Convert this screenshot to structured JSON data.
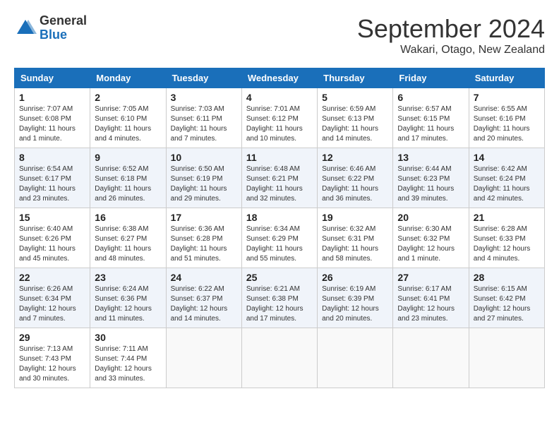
{
  "logo": {
    "general": "General",
    "blue": "Blue"
  },
  "header": {
    "month": "September 2024",
    "location": "Wakari, Otago, New Zealand"
  },
  "weekdays": [
    "Sunday",
    "Monday",
    "Tuesday",
    "Wednesday",
    "Thursday",
    "Friday",
    "Saturday"
  ],
  "weeks": [
    [
      {
        "day": "1",
        "info": "Sunrise: 7:07 AM\nSunset: 6:08 PM\nDaylight: 11 hours\nand 1 minute."
      },
      {
        "day": "2",
        "info": "Sunrise: 7:05 AM\nSunset: 6:10 PM\nDaylight: 11 hours\nand 4 minutes."
      },
      {
        "day": "3",
        "info": "Sunrise: 7:03 AM\nSunset: 6:11 PM\nDaylight: 11 hours\nand 7 minutes."
      },
      {
        "day": "4",
        "info": "Sunrise: 7:01 AM\nSunset: 6:12 PM\nDaylight: 11 hours\nand 10 minutes."
      },
      {
        "day": "5",
        "info": "Sunrise: 6:59 AM\nSunset: 6:13 PM\nDaylight: 11 hours\nand 14 minutes."
      },
      {
        "day": "6",
        "info": "Sunrise: 6:57 AM\nSunset: 6:15 PM\nDaylight: 11 hours\nand 17 minutes."
      },
      {
        "day": "7",
        "info": "Sunrise: 6:55 AM\nSunset: 6:16 PM\nDaylight: 11 hours\nand 20 minutes."
      }
    ],
    [
      {
        "day": "8",
        "info": "Sunrise: 6:54 AM\nSunset: 6:17 PM\nDaylight: 11 hours\nand 23 minutes."
      },
      {
        "day": "9",
        "info": "Sunrise: 6:52 AM\nSunset: 6:18 PM\nDaylight: 11 hours\nand 26 minutes."
      },
      {
        "day": "10",
        "info": "Sunrise: 6:50 AM\nSunset: 6:19 PM\nDaylight: 11 hours\nand 29 minutes."
      },
      {
        "day": "11",
        "info": "Sunrise: 6:48 AM\nSunset: 6:21 PM\nDaylight: 11 hours\nand 32 minutes."
      },
      {
        "day": "12",
        "info": "Sunrise: 6:46 AM\nSunset: 6:22 PM\nDaylight: 11 hours\nand 36 minutes."
      },
      {
        "day": "13",
        "info": "Sunrise: 6:44 AM\nSunset: 6:23 PM\nDaylight: 11 hours\nand 39 minutes."
      },
      {
        "day": "14",
        "info": "Sunrise: 6:42 AM\nSunset: 6:24 PM\nDaylight: 11 hours\nand 42 minutes."
      }
    ],
    [
      {
        "day": "15",
        "info": "Sunrise: 6:40 AM\nSunset: 6:26 PM\nDaylight: 11 hours\nand 45 minutes."
      },
      {
        "day": "16",
        "info": "Sunrise: 6:38 AM\nSunset: 6:27 PM\nDaylight: 11 hours\nand 48 minutes."
      },
      {
        "day": "17",
        "info": "Sunrise: 6:36 AM\nSunset: 6:28 PM\nDaylight: 11 hours\nand 51 minutes."
      },
      {
        "day": "18",
        "info": "Sunrise: 6:34 AM\nSunset: 6:29 PM\nDaylight: 11 hours\nand 55 minutes."
      },
      {
        "day": "19",
        "info": "Sunrise: 6:32 AM\nSunset: 6:31 PM\nDaylight: 11 hours\nand 58 minutes."
      },
      {
        "day": "20",
        "info": "Sunrise: 6:30 AM\nSunset: 6:32 PM\nDaylight: 12 hours\nand 1 minute."
      },
      {
        "day": "21",
        "info": "Sunrise: 6:28 AM\nSunset: 6:33 PM\nDaylight: 12 hours\nand 4 minutes."
      }
    ],
    [
      {
        "day": "22",
        "info": "Sunrise: 6:26 AM\nSunset: 6:34 PM\nDaylight: 12 hours\nand 7 minutes."
      },
      {
        "day": "23",
        "info": "Sunrise: 6:24 AM\nSunset: 6:36 PM\nDaylight: 12 hours\nand 11 minutes."
      },
      {
        "day": "24",
        "info": "Sunrise: 6:22 AM\nSunset: 6:37 PM\nDaylight: 12 hours\nand 14 minutes."
      },
      {
        "day": "25",
        "info": "Sunrise: 6:21 AM\nSunset: 6:38 PM\nDaylight: 12 hours\nand 17 minutes."
      },
      {
        "day": "26",
        "info": "Sunrise: 6:19 AM\nSunset: 6:39 PM\nDaylight: 12 hours\nand 20 minutes."
      },
      {
        "day": "27",
        "info": "Sunrise: 6:17 AM\nSunset: 6:41 PM\nDaylight: 12 hours\nand 23 minutes."
      },
      {
        "day": "28",
        "info": "Sunrise: 6:15 AM\nSunset: 6:42 PM\nDaylight: 12 hours\nand 27 minutes."
      }
    ],
    [
      {
        "day": "29",
        "info": "Sunrise: 7:13 AM\nSunset: 7:43 PM\nDaylight: 12 hours\nand 30 minutes."
      },
      {
        "day": "30",
        "info": "Sunrise: 7:11 AM\nSunset: 7:44 PM\nDaylight: 12 hours\nand 33 minutes."
      },
      null,
      null,
      null,
      null,
      null
    ]
  ]
}
